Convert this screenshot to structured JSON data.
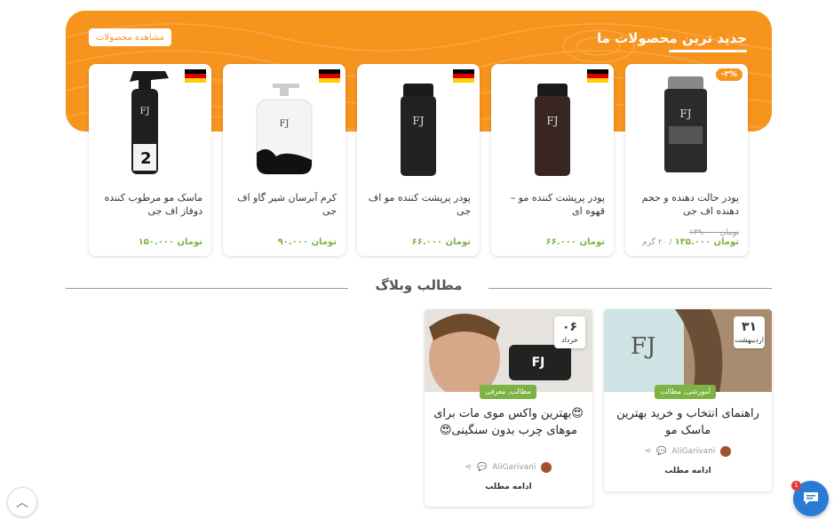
{
  "products_section": {
    "title": "جدید ترین محصولات ما",
    "view_all_label": "مشاهده محصولات",
    "accent_color": "#f7941d",
    "products": [
      {
        "name": "پودر حالت دهنده و حجم دهنده اف جی",
        "old_price": "تومان ۱۳۹.۰۰۰",
        "price": "تومان ۱۳۵.۰۰۰",
        "unit": "/ ۲۰ گرم",
        "badge": "-۳%",
        "flag": "germany",
        "image": "hair-styling-powder-bottle"
      },
      {
        "name": "پودر پرپشت کننده مو – قهوه ای",
        "price": "تومان ۶۶.۰۰۰",
        "flag": "germany",
        "image": "hair-building-fiber-brown"
      },
      {
        "name": "پودر پرپشت کننده مو اف جی",
        "price": "تومان ۶۶.۰۰۰",
        "flag": "germany",
        "image": "hair-building-fiber-black"
      },
      {
        "name": "کرم آبرسان شیر گاو اف جی",
        "price": "تومان ۹۰.۰۰۰",
        "flag": "germany",
        "image": "cow-milk-pump-bottle",
        "label": "COW MILK"
      },
      {
        "name": "ماسک مو مرطوب کننده دوفاز اف جی",
        "price": "تومان ۱۵۰.۰۰۰",
        "flag": "germany",
        "image": "spray-bottle-two-phase",
        "label": "2"
      }
    ]
  },
  "blog_section": {
    "title": "مطالب وبلاگ",
    "posts": [
      {
        "day": "۳۱",
        "month": "اردیبهشت",
        "category": "آموزشی, مطالب",
        "title": "راهنمای انتخاب و خرید بهترین ماسک مو",
        "author": "AliGarivani",
        "read_more": "ادامه مطلب",
        "image": "woman-hair-mask"
      },
      {
        "day": "۰۶",
        "month": "خرداد",
        "category": "مطالب, معرفی",
        "title": "😍بهترین واکس موی مات برای موهای چرب بدون سنگینی😍",
        "author": "AliGarivani",
        "read_more": "ادامه مطلب",
        "image": "man-hair-wax",
        "label": "FJ"
      }
    ]
  },
  "widgets": {
    "chat_badge": "1",
    "scroll_top_icon": "chevron-up-icon",
    "chat_icon": "chat-bubble-icon"
  }
}
